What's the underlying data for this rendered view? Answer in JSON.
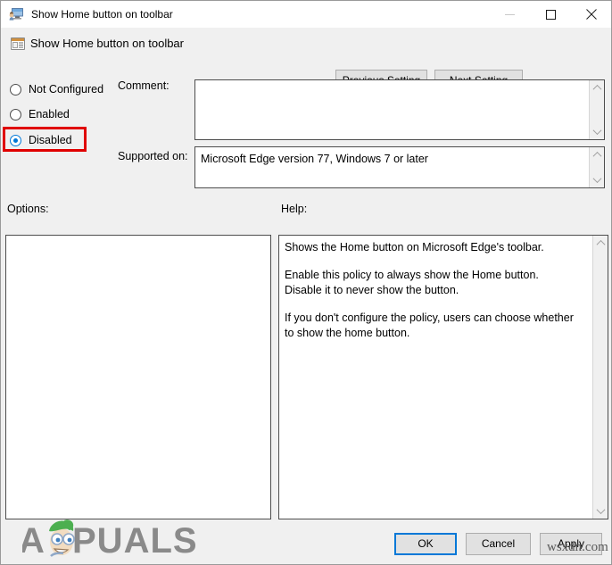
{
  "window": {
    "title": "Show Home button on toolbar",
    "title_icon": "policy-setting-window-icon",
    "minimize_icon": "minimize-icon",
    "maximize_icon": "maximize-icon",
    "close_icon": "close-icon"
  },
  "header": {
    "icon": "policy-document-icon",
    "title": "Show Home button on toolbar",
    "previous_setting_label": "Previous Setting",
    "next_setting_label": "Next Setting"
  },
  "state_options": [
    {
      "label": "Not Configured",
      "selected": false
    },
    {
      "label": "Enabled",
      "selected": false
    },
    {
      "label": "Disabled",
      "selected": true
    }
  ],
  "highlight": {
    "target": "Disabled",
    "color": "#e00000"
  },
  "fields": {
    "comment_label": "Comment:",
    "comment_value": "",
    "supported_on_label": "Supported on:",
    "supported_on_value": "Microsoft Edge version 77, Windows 7 or later"
  },
  "panes": {
    "options_label": "Options:",
    "options_content": "",
    "help_label": "Help:",
    "help_paragraphs": [
      "Shows the Home button on Microsoft Edge's toolbar.",
      "Enable this policy to always show the Home button. Disable it to never show the button.",
      "If you don't configure the policy, users can choose whether to show the home button."
    ]
  },
  "footer": {
    "ok_label": "OK",
    "cancel_label": "Cancel",
    "apply_label": "Apply",
    "focused_button": "OK",
    "focus_color": "#0078d7"
  },
  "watermarks": {
    "logo_text": "PUALS",
    "site_text": "wsxdn.com"
  },
  "scroll": {
    "up_icon": "chevron-up-icon",
    "down_icon": "chevron-down-icon"
  }
}
